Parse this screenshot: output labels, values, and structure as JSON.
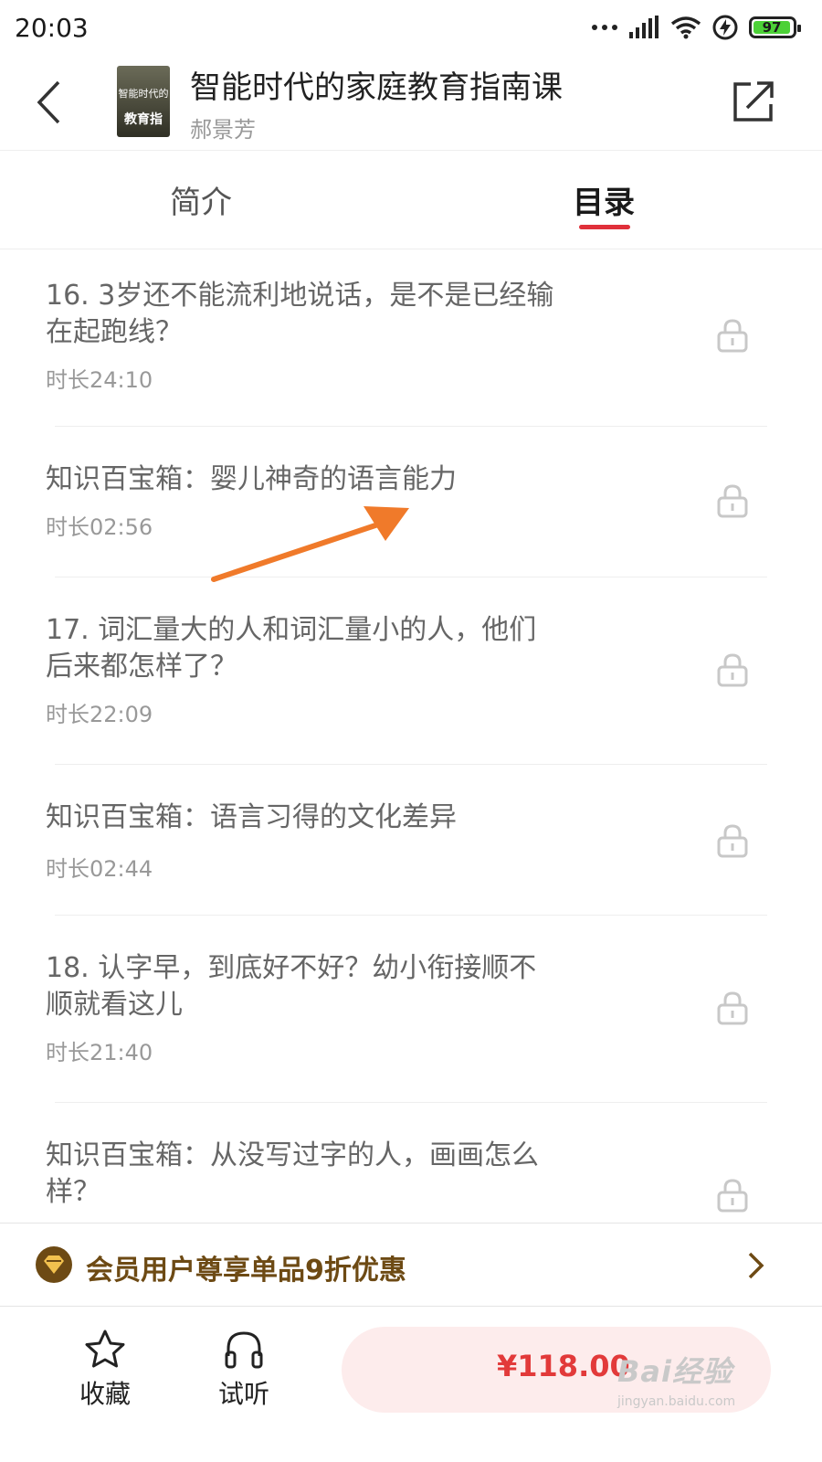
{
  "status": {
    "time": "20:03",
    "battery": "97"
  },
  "header": {
    "title": "智能时代的家庭教育指南课",
    "author": "郝景芳",
    "cover_line1": "智能时代的",
    "cover_line2": "教育指"
  },
  "tabs": {
    "intro": "简介",
    "catalog": "目录"
  },
  "items": [
    {
      "title": "16. 3岁还不能流利地说话，是不是已经输在起跑线？",
      "duration": "时长24:10"
    },
    {
      "title": "知识百宝箱：婴儿神奇的语言能力",
      "duration": "时长02:56"
    },
    {
      "title": "17. 词汇量大的人和词汇量小的人，他们后来都怎样了？",
      "duration": "时长22:09"
    },
    {
      "title": "知识百宝箱：语言习得的文化差异",
      "duration": "时长02:44"
    },
    {
      "title": "18. 认字早，到底好不好？幼小衔接顺不顺就看这儿",
      "duration": "时长21:40"
    },
    {
      "title": "知识百宝箱：从没写过字的人，画画怎么样？",
      "duration": ""
    }
  ],
  "member": {
    "text": "会员用户尊享单品9折优惠"
  },
  "bottom": {
    "favorite": "收藏",
    "listen": "试听",
    "price": "¥118.00"
  },
  "watermark": {
    "main": "Bai经验",
    "sub": "jingyan.baidu.com"
  },
  "colors": {
    "accent": "#e0303a",
    "price": "#e23a3a",
    "member_text": "#6d4a14",
    "buy_bg": "#fdecec",
    "annotation": "#f07a2a"
  }
}
